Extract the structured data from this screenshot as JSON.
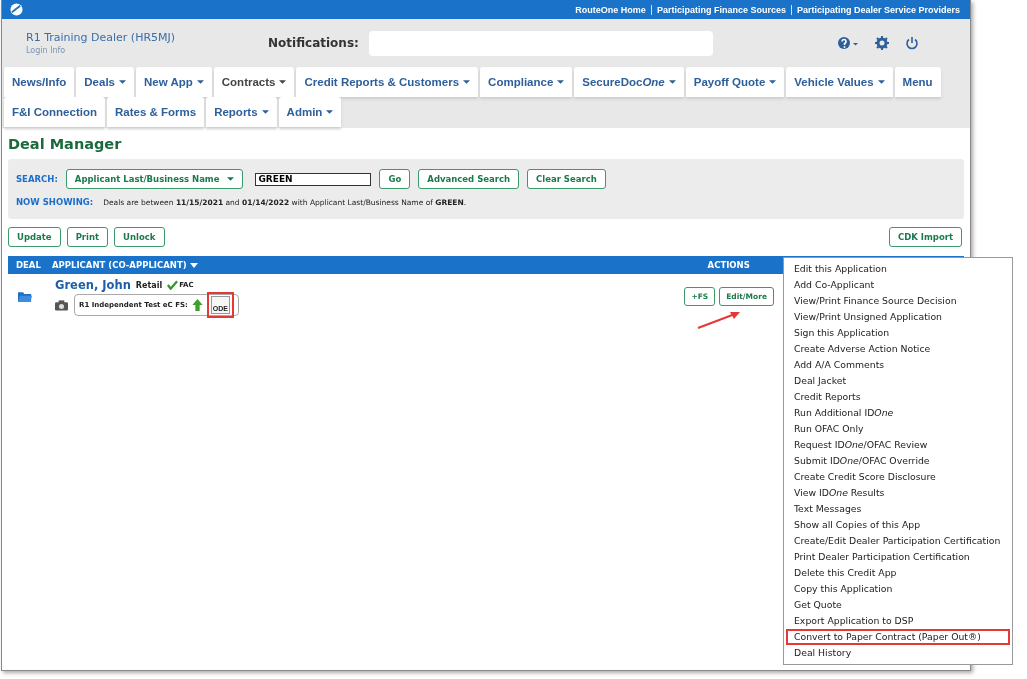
{
  "top_links": [
    "RouteOne Home",
    "Participating Finance Sources",
    "Participating Dealer Service Providers"
  ],
  "dealer": {
    "name": "R1 Training Dealer (HR5MJ)",
    "login": "Login Info"
  },
  "notifications": {
    "label": "Notifications:"
  },
  "tabs": [
    [
      {
        "label": "News/Info",
        "dropdown": false,
        "selected": false
      },
      {
        "label": "Deals",
        "dropdown": true,
        "selected": false
      },
      {
        "label": "New App",
        "dropdown": true,
        "selected": false
      },
      {
        "label": "Contracts",
        "dropdown": true,
        "selected": true
      },
      {
        "label": "Credit Reports & Customers",
        "dropdown": true,
        "selected": false
      },
      {
        "label": "Compliance",
        "dropdown": true,
        "selected": false
      },
      {
        "label": [
          {
            "text": "SecureDoc",
            "italic": false
          },
          {
            "text": "One",
            "italic": true
          }
        ],
        "dropdown": true,
        "selected": false
      },
      {
        "label": "Payoff Quote",
        "dropdown": true,
        "selected": false
      },
      {
        "label": "Vehicle Values",
        "dropdown": true,
        "selected": false
      },
      {
        "label": "Menu",
        "dropdown": false,
        "selected": false
      }
    ],
    [
      {
        "label": "F&I Connection",
        "dropdown": false,
        "selected": false
      },
      {
        "label": "Rates & Forms",
        "dropdown": false,
        "selected": false
      },
      {
        "label": "Reports",
        "dropdown": true,
        "selected": false
      },
      {
        "label": "Admin",
        "dropdown": true,
        "selected": false
      }
    ]
  ],
  "page_title": "Deal Manager",
  "search": {
    "label": "SEARCH:",
    "field_type": "Applicant Last/Business Name",
    "value": "GREEN",
    "buttons": [
      "Go",
      "Advanced Search",
      "Clear Search"
    ]
  },
  "now_showing": {
    "label": "NOW SHOWING:",
    "text": "Deals are between **11/15/2021** and **01/14/2022** with Applicant Last/Business Name of **GREEN**."
  },
  "actions_left": [
    "Update",
    "Print",
    "Unlock"
  ],
  "cdk_button": "CDK Import",
  "table": {
    "columns": [
      "DEAL",
      "APPLICANT (CO-APPLICANT)",
      "ACTIONS"
    ],
    "rows": [
      {
        "name": "Green, John",
        "type": "Retail",
        "ofac": "FAC",
        "finance_source": "R1 Independent Test eC FS:",
        "ode": "ODE",
        "ode_highlighted": true,
        "buttons": [
          "+FS",
          "Edit/More"
        ]
      }
    ]
  },
  "menu": [
    {
      "label": "Edit this Application",
      "highlighted": false
    },
    {
      "label": "Add Co-Applicant",
      "highlighted": false
    },
    {
      "label": "View/Print Finance Source Decision",
      "highlighted": false
    },
    {
      "label": "View/Print Unsigned Application",
      "highlighted": false
    },
    {
      "label": "Sign this Application",
      "highlighted": false
    },
    {
      "label": "Create Adverse Action Notice",
      "highlighted": false
    },
    {
      "label": "Add A/A Comments",
      "highlighted": false
    },
    {
      "label": "Deal Jacket",
      "highlighted": false
    },
    {
      "label": "Credit Reports",
      "highlighted": false
    },
    {
      "label": [
        {
          "text": "Run Additional ID",
          "italic": false
        },
        {
          "text": "One",
          "italic": true
        }
      ],
      "highlighted": false
    },
    {
      "label": "Run OFAC Only",
      "highlighted": false
    },
    {
      "label": [
        {
          "text": "Request ID",
          "italic": false
        },
        {
          "text": "One",
          "italic": true
        },
        {
          "text": "/OFAC Review",
          "italic": false
        }
      ],
      "highlighted": false
    },
    {
      "label": [
        {
          "text": "Submit ID",
          "italic": false
        },
        {
          "text": "One",
          "italic": true
        },
        {
          "text": "/OFAC Override",
          "italic": false
        }
      ],
      "highlighted": false
    },
    {
      "label": "Create Credit Score Disclosure",
      "highlighted": false
    },
    {
      "label": [
        {
          "text": "View ID",
          "italic": false
        },
        {
          "text": "One",
          "italic": true
        },
        {
          "text": " Results",
          "italic": false
        }
      ],
      "highlighted": false
    },
    {
      "label": "Text Messages",
      "highlighted": false
    },
    {
      "label": "Show all Copies of this App",
      "highlighted": false
    },
    {
      "label": "Create/Edit Dealer Participation Certification",
      "highlighted": false
    },
    {
      "label": "Print Dealer Participation Certification",
      "highlighted": false
    },
    {
      "label": "Delete this Credit App",
      "highlighted": false
    },
    {
      "label": "Copy this Application",
      "highlighted": false
    },
    {
      "label": "Get Quote",
      "highlighted": false
    },
    {
      "label": "Export Application to DSP",
      "highlighted": false
    },
    {
      "label": "Convert to Paper Contract (Paper Out®)",
      "highlighted": true
    },
    {
      "label": "Deal History",
      "highlighted": false
    }
  ]
}
